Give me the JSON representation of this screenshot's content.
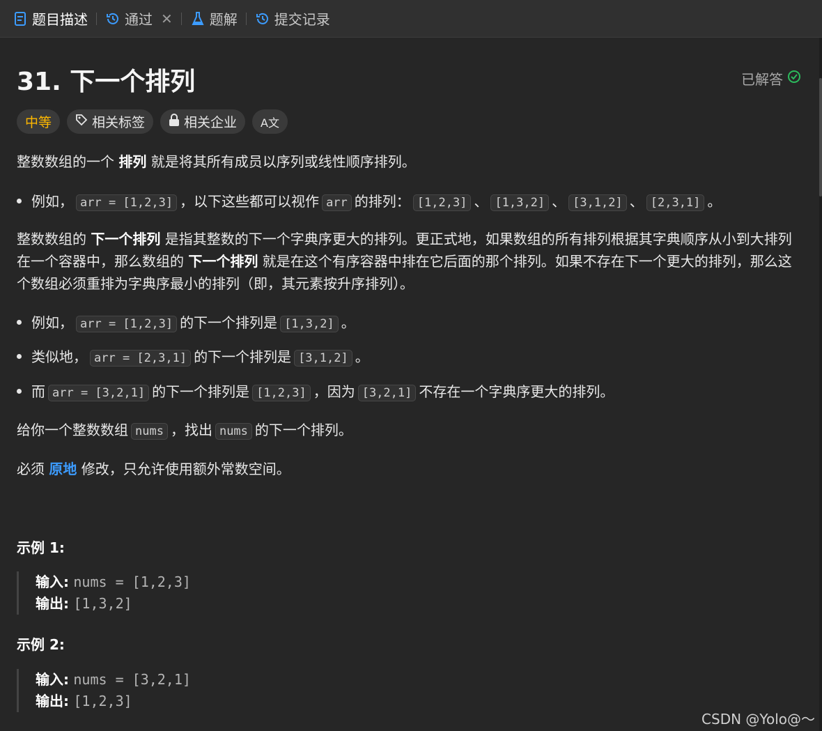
{
  "tabs": [
    {
      "label": "题目描述",
      "icon": "description-icon",
      "active": true
    },
    {
      "label": "通过",
      "icon": "history-icon",
      "closable": true
    },
    {
      "label": "题解",
      "icon": "flask-icon"
    },
    {
      "label": "提交记录",
      "icon": "history-icon"
    }
  ],
  "problem": {
    "title": "31. 下一个排列",
    "status": "已解答",
    "difficulty": "中等",
    "tags_label": "相关标签",
    "company_label": "相关企业",
    "translate_glyph": "A文"
  },
  "desc": {
    "p1_a": "整数数组的一个",
    "p1_b": "排列",
    "p1_c": "就是将其所有成员以序列或线性顺序排列。",
    "b1_a": "例如，",
    "b1_code1": "arr = [1,2,3]",
    "b1_b": "，以下这些都可以视作",
    "b1_code2": "arr",
    "b1_c": "的排列：",
    "b1_p1": "[1,2,3]",
    "b1_sep1": "、",
    "b1_p2": "[1,3,2]",
    "b1_sep2": "、",
    "b1_p3": "[3,1,2]",
    "b1_sep3": "、",
    "b1_p4": "[2,3,1]",
    "b1_end": "。",
    "p2_a": "整数数组的",
    "p2_b": "下一个排列",
    "p2_c": "是指其整数的下一个字典序更大的排列。更正式地，如果数组的所有排列根据其字典顺序从小到大排列在一个容器中，那么数组的",
    "p2_d": "下一个排列",
    "p2_e": "就是在这个有序容器中排在它后面的那个排列。如果不存在下一个更大的排列，那么这个数组必须重排为字典序最小的排列（即，其元素按升序排列）。",
    "b2_a": "例如，",
    "b2_code1": "arr = [1,2,3]",
    "b2_b": "的下一个排列是",
    "b2_code2": "[1,3,2]",
    "b2_end": "。",
    "b3_a": "类似地，",
    "b3_code1": "arr = [2,3,1]",
    "b3_b": "的下一个排列是",
    "b3_code2": "[3,1,2]",
    "b3_end": "。",
    "b4_a": "而",
    "b4_code1": "arr = [3,2,1]",
    "b4_b": "的下一个排列是",
    "b4_code2": "[1,2,3]",
    "b4_c": "，因为",
    "b4_code3": "[3,2,1]",
    "b4_d": "不存在一个字典序更大的排列。",
    "p3_a": "给你一个整数数组",
    "p3_code1": "nums",
    "p3_b": "，找出",
    "p3_code2": "nums",
    "p3_c": "的下一个排列。",
    "p4_a": "必须",
    "p4_b": "原地",
    "p4_c": "修改，只允许使用额外常数空间。"
  },
  "examples": [
    {
      "title": "示例 1:",
      "input_label": "输入:",
      "input": "nums = [1,2,3]",
      "output_label": "输出:",
      "output": "[1,3,2]"
    },
    {
      "title": "示例 2:",
      "input_label": "输入:",
      "input": "nums = [3,2,1]",
      "output_label": "输出:",
      "output": "[1,2,3]"
    }
  ],
  "watermark": "CSDN @Yolo@～",
  "colors": {
    "accent_blue": "#3c9cff",
    "difficulty_medium": "#ffb800",
    "solved_green": "#2cbb5d"
  }
}
